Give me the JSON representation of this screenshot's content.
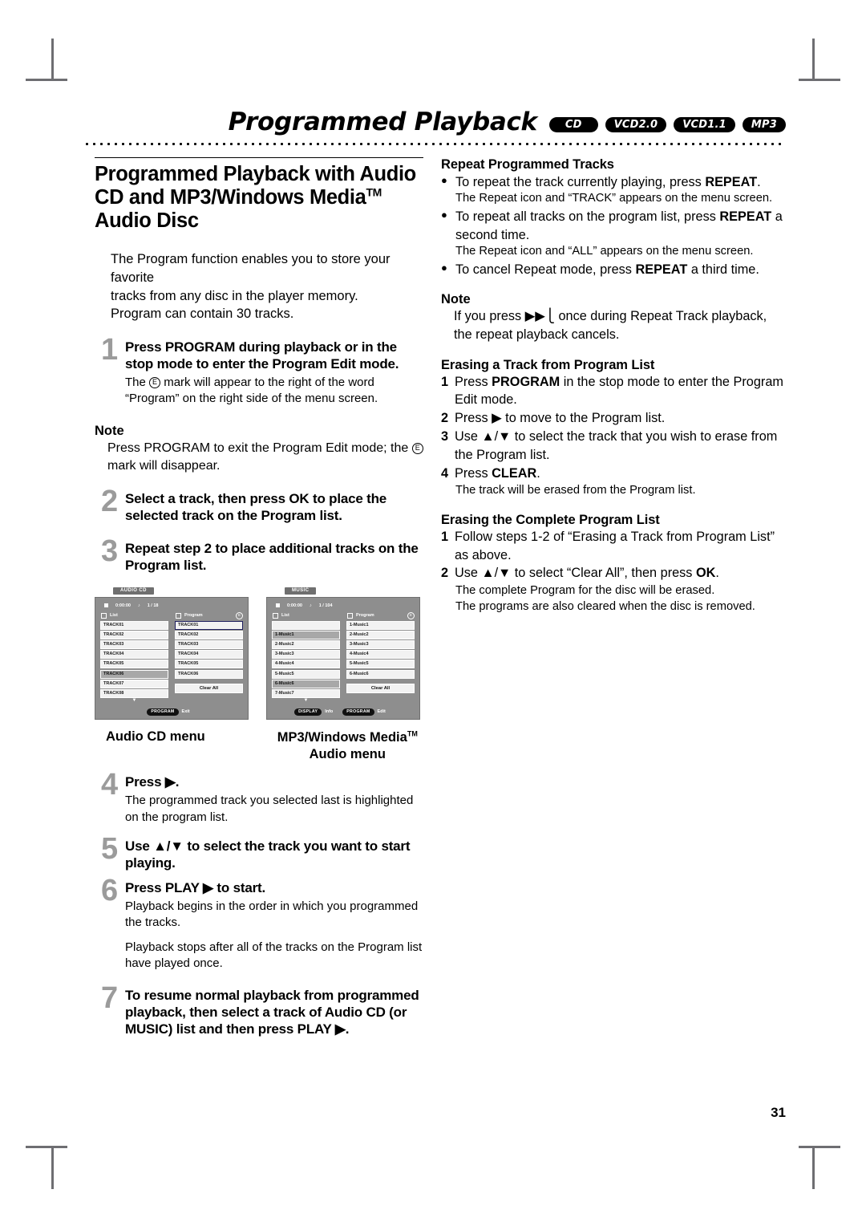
{
  "header": {
    "title": "Programmed Playback",
    "badges": [
      "CD",
      "VCD2.0",
      "VCD1.1",
      "MP3"
    ]
  },
  "page_number": "31",
  "left": {
    "section_title_line1": "Programmed Playback with Audio",
    "section_title_line2_a": "CD and MP3/Windows Media",
    "section_title_tm": "TM",
    "section_title_line3": "Audio Disc",
    "intro": [
      "The Program function enables you to store your favorite",
      "tracks from any disc in the player memory.",
      "Program can contain 30 tracks."
    ],
    "steps": [
      {
        "num": "1",
        "lead": "Press PROGRAM during playback or in the stop mode to enter the Program Edit mode.",
        "sub_before": "The",
        "sub_after": "mark will appear to the right of the word “Program” on the right side of the menu screen."
      },
      {
        "num": "2",
        "lead": "Select a track, then press OK to place the selected track on the Program list.",
        "sub_before": "",
        "sub_after": ""
      },
      {
        "num": "3",
        "lead": "Repeat step 2 to place additional tracks on the Program list.",
        "sub_before": "",
        "sub_after": ""
      }
    ],
    "note": {
      "title": "Note",
      "text_before": "Press PROGRAM to exit the Program Edit mode; the",
      "text_after": "mark will disappear."
    },
    "step4": {
      "num": "4",
      "lead": "Press ▶.",
      "sub": "The programmed track you selected last is highlighted on the program list."
    },
    "step5": {
      "num": "5",
      "lead": "Use ▲/▼ to select the track you want to start playing."
    },
    "step6": {
      "num": "6",
      "lead": "Press PLAY ▶ to start.",
      "sub1": "Playback begins in the order in which you programmed the tracks.",
      "sub2": "Playback stops after all of the tracks on the Program list have played once."
    },
    "step7": {
      "num": "7",
      "lead": "To resume normal playback from programmed playback, then select a track of Audio CD (or MUSIC) list and then press PLAY ▶."
    },
    "captions": {
      "audio_cd": "Audio CD menu",
      "mp3_line1": "MP3/Windows Media",
      "mp3_tm": "TM",
      "mp3_line2": "Audio menu"
    }
  },
  "screens": {
    "audio_cd": {
      "tab": "AUDIO CD",
      "time": "0:00:00",
      "counter": "1 / 18",
      "list_label": "List",
      "program_label": "Program",
      "edit_mark": "E",
      "list_items": [
        "TRACK01",
        "TRACK02",
        "TRACK03",
        "TRACK04",
        "TRACK05",
        "TRACK06",
        "TRACK07",
        "TRACK08"
      ],
      "list_selected_index": 5,
      "program_items": [
        "TRACK01",
        "TRACK02",
        "TRACK03",
        "TRACK04",
        "TRACK05",
        "TRACK06"
      ],
      "clear_all": "Clear All",
      "footer": [
        {
          "key": "PROGRAM",
          "label": "Exit"
        }
      ]
    },
    "music": {
      "tab": "MUSIC",
      "time": "0:00:00",
      "counter": "1 / 104",
      "list_label": "List",
      "program_label": "Program",
      "edit_mark": "E",
      "list_items": [
        "",
        "1-Music1",
        "2-Music2",
        "3-Music3",
        "4-Music4",
        "5-Music5",
        "6-Music6",
        "7-Music7"
      ],
      "list_selected_index": 1,
      "program_items": [
        "1-Music1",
        "2-Music2",
        "3-Music3",
        "4-Music4",
        "5-Music5",
        "6-Music6"
      ],
      "clear_all": "Clear All",
      "footer": [
        {
          "key": "DISPLAY",
          "label": "Info"
        },
        {
          "key": "PROGRAM",
          "label": "Edit"
        }
      ]
    }
  },
  "right": {
    "repeat": {
      "heading": "Repeat Programmed Tracks",
      "bullets": [
        {
          "text_plain_1": "To repeat the track currently playing, press ",
          "text_bold": "REPEAT",
          "text_plain_2": ".",
          "sub": "The Repeat icon and “TRACK” appears on the menu screen."
        },
        {
          "text_plain_1": "To repeat all tracks on the program list, press ",
          "text_bold": "REPEAT",
          "text_plain_2": " a second time.",
          "sub": "The Repeat icon and “ALL” appears on the menu screen."
        },
        {
          "text_plain_1": "To cancel Repeat mode, press ",
          "text_bold": "REPEAT",
          "text_plain_2": " a third time.",
          "sub": ""
        }
      ]
    },
    "note": {
      "title": "Note",
      "text": "If you press ▶▶⎩ once during Repeat Track playback, the repeat playback cancels."
    },
    "erase_track": {
      "heading": "Erasing a Track from Program List",
      "items": [
        {
          "n": "1",
          "plain_1": "Press ",
          "bold": "PROGRAM",
          "plain_2": " in the stop mode to enter the Program Edit  mode.",
          "sub": ""
        },
        {
          "n": "2",
          "plain_1": "Press ▶ to move to the Program list.",
          "bold": "",
          "plain_2": "",
          "sub": ""
        },
        {
          "n": "3",
          "plain_1": "Use ▲/▼ to select the track that you wish to erase from the Program list.",
          "bold": "",
          "plain_2": "",
          "sub": ""
        },
        {
          "n": "4",
          "plain_1": "Press ",
          "bold": "CLEAR",
          "plain_2": ".",
          "sub": "The track will be erased from the Program list."
        }
      ]
    },
    "erase_all": {
      "heading": "Erasing the Complete Program List",
      "items": [
        {
          "n": "1",
          "plain_1": "Follow steps 1-2 of “Erasing a Track from Program List” as above.",
          "bold": "",
          "plain_2": "",
          "subs": []
        },
        {
          "n": "2",
          "plain_1": "Use ▲/▼ to select “Clear All”, then press ",
          "bold": "OK",
          "plain_2": ".",
          "subs": [
            "The complete Program for the disc will be erased.",
            "The programs are also cleared when the disc is removed."
          ]
        }
      ]
    }
  }
}
